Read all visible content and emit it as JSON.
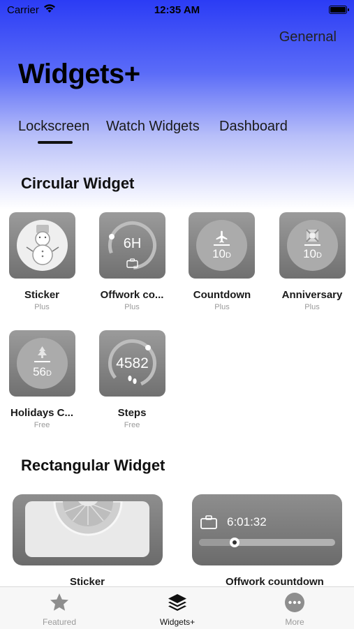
{
  "status": {
    "carrier": "Carrier",
    "time": "12:35 AM"
  },
  "header": {
    "general_link": "Genernal",
    "title": "Widgets+"
  },
  "tabs": [
    {
      "label": "Lockscreen"
    },
    {
      "label": "Watch Widgets"
    },
    {
      "label": "Dashboard"
    }
  ],
  "circular": {
    "title": "Circular Widget",
    "items": [
      {
        "name": "Sticker",
        "tag": "Plus"
      },
      {
        "name": "Offwork co...",
        "tag": "Plus",
        "value": "6H"
      },
      {
        "name": "Countdown",
        "tag": "Plus",
        "value": "10",
        "unit": "D"
      },
      {
        "name": "Anniversary",
        "tag": "Plus",
        "value": "10",
        "unit": "D"
      },
      {
        "name": "Holidays C...",
        "tag": "Free",
        "value": "56",
        "unit": "D"
      },
      {
        "name": "Steps",
        "tag": "Free",
        "value": "4582"
      }
    ]
  },
  "rectangular": {
    "title": "Rectangular Widget",
    "items": [
      {
        "name": "Sticker"
      },
      {
        "name": "Offwork countdown",
        "value": "6:01:32",
        "progress": 0.2
      }
    ]
  },
  "tabbar": [
    {
      "label": "Featured",
      "icon": "star-icon"
    },
    {
      "label": "Widgets+",
      "icon": "layers-icon"
    },
    {
      "label": "More",
      "icon": "more-icon"
    }
  ]
}
